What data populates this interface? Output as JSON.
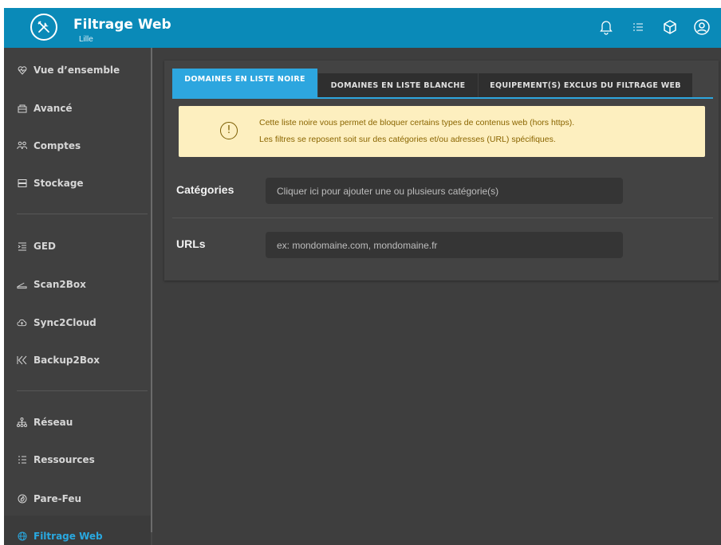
{
  "app": {
    "title": "Filtrage Web",
    "subtitle": "Lille"
  },
  "header": {
    "icons": [
      "bell-icon",
      "checklist-icon",
      "cube-icon",
      "account-icon"
    ]
  },
  "sidebar": {
    "items": [
      {
        "label": "Vue d’ensemble",
        "icon": "overview-icon"
      },
      {
        "label": "Avancé",
        "icon": "advanced-icon"
      },
      {
        "label": "Comptes",
        "icon": "accounts-icon"
      },
      {
        "label": "Stockage",
        "icon": "storage-icon"
      },
      {
        "label": "GED",
        "icon": "ged-icon"
      },
      {
        "label": "Scan2Box",
        "icon": "scan-icon"
      },
      {
        "label": "Sync2Cloud",
        "icon": "cloud-sync-icon"
      },
      {
        "label": "Backup2Box",
        "icon": "backup-icon"
      },
      {
        "label": "Réseau",
        "icon": "network-icon"
      },
      {
        "label": "Ressources",
        "icon": "resources-icon"
      },
      {
        "label": "Pare-Feu",
        "icon": "firewall-icon"
      },
      {
        "label": "Filtrage Web",
        "icon": "globe-icon",
        "active": true
      }
    ]
  },
  "tabs": [
    {
      "label": "DOMAINES EN LISTE NOIRE",
      "active": true
    },
    {
      "label": "DOMAINES EN LISTE BLANCHE",
      "active": false
    },
    {
      "label": "EQUIPEMENT(S) EXCLUS DU FILTRAGE WEB",
      "active": false
    }
  ],
  "alert": {
    "line1": "Cette liste noire vous permet de bloquer certains types de contenus web (hors https).",
    "line2": "Les filtres se reposent soit sur des catégories et/ou adresses (URL) spécifiques.",
    "icon": "warning-icon"
  },
  "form": {
    "categories": {
      "label": "Catégories",
      "placeholder": "Cliquer ici pour ajouter une ou plusieurs catégorie(s)"
    },
    "urls": {
      "label": "URLs",
      "placeholder": "ex: mondomaine.com, mondomaine.fr"
    }
  },
  "colors": {
    "topbar": "#0a8ab8",
    "accent": "#2da6df",
    "alert_bg": "#fdefbf",
    "sidebar_bg": "#404040",
    "main_bg": "#3e3e3e"
  }
}
